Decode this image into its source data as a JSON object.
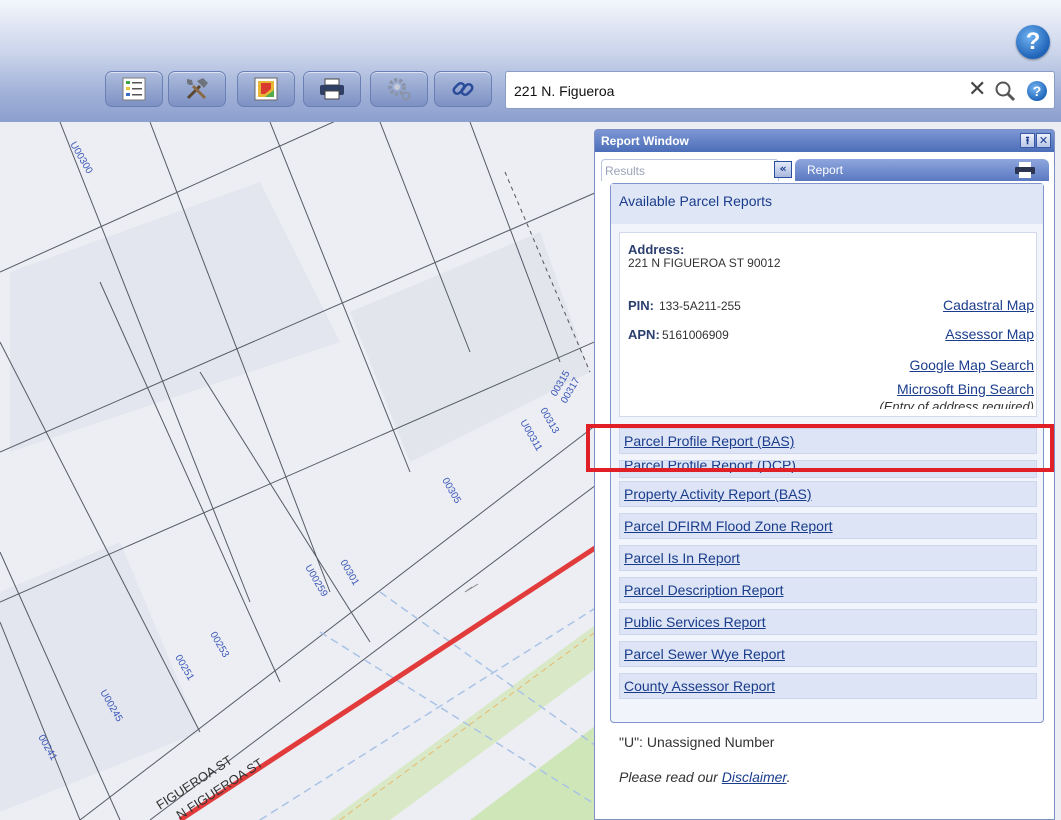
{
  "toolbar": {
    "help_icon": "question-icon",
    "buttons": [
      {
        "name": "layers-list-button",
        "icon": "layers-list-icon"
      },
      {
        "name": "tools-button",
        "icon": "tools-icon"
      },
      {
        "name": "basemap-button",
        "icon": "basemap-icon"
      },
      {
        "name": "print-button",
        "icon": "printer-icon"
      },
      {
        "name": "settings-button",
        "icon": "gear-icon"
      },
      {
        "name": "link-button",
        "icon": "link-icon"
      }
    ]
  },
  "search": {
    "value": "221 N. Figueroa",
    "clear_glyph": "✕",
    "help_glyph": "?"
  },
  "map": {
    "parcel_labels": [
      "U00300",
      "00305",
      "00301",
      "U00259",
      "00253",
      "00251",
      "U00245",
      "00241",
      "U00311",
      "00313",
      "00315",
      "00317"
    ],
    "street_labels": [
      "FIGUEROA ST",
      "N FIGUEROA ST"
    ],
    "colors": {
      "street_line": "#e23b3b",
      "green_strip": "#cfe6b8",
      "parcel_line": "#555a66"
    }
  },
  "report_window": {
    "title": "Report Window",
    "tabs": {
      "results": "Results",
      "collapse_glyph": "«",
      "report": "Report"
    },
    "available_title": "Available Parcel Reports",
    "address_label": "Address:",
    "address_value": "221 N FIGUEROA ST 90012",
    "pin_label": "PIN:",
    "pin_value": "133-5A211-255",
    "apn_label": "APN:",
    "apn_value": "5161006909",
    "links": {
      "cadastral": "Cadastral Map",
      "assessor": "Assessor Map",
      "google": "Google Map Search",
      "bing": "Microsoft Bing Search",
      "bing_note": "(Entry of address required)"
    },
    "reports": [
      "Parcel Profile Report (BAS)",
      "Parcel Profile Report (DCP)",
      "Property Activity Report (BAS)",
      "Parcel DFIRM Flood Zone Report",
      "Parcel Is In Report",
      "Parcel Description Report",
      "Public Services Report",
      "Parcel Sewer Wye Report",
      "County Assessor Report"
    ],
    "legend_note": "\"U\": Unassigned Number",
    "disclaimer_prefix": "Please read our ",
    "disclaimer_link": "Disclaimer",
    "disclaimer_suffix": "."
  },
  "highlight": {
    "color": "#e11f26",
    "target": "Parcel Profile Report (BAS)"
  }
}
